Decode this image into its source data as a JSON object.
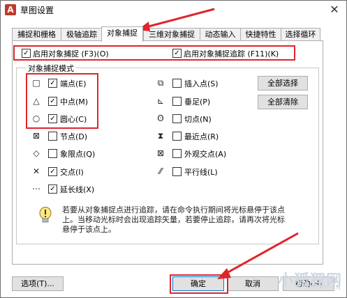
{
  "window": {
    "title": "草图设置",
    "close_glyph": "✕"
  },
  "tabs": [
    {
      "label": "捕捉和栅格"
    },
    {
      "label": "极轴追踪"
    },
    {
      "label": "对象捕捉",
      "active": true
    },
    {
      "label": "三维对象捕捉"
    },
    {
      "label": "动态输入"
    },
    {
      "label": "快捷特性"
    },
    {
      "label": "选择循环"
    }
  ],
  "top_checks": {
    "osnap_on": {
      "label": "启用对象捕捉 (F3)(O)",
      "checked": true
    },
    "tracking_on": {
      "label": "启用对象捕捉追踪 (F11)(K)",
      "checked": true
    }
  },
  "group_title": "对象捕捉模式",
  "left_modes": [
    {
      "icon": "□",
      "icon_name": "endpoint-icon",
      "label": "端点(E)",
      "checked": true
    },
    {
      "icon": "△",
      "icon_name": "midpoint-icon",
      "label": "中点(M)",
      "checked": true
    },
    {
      "icon": "○",
      "icon_name": "center-icon",
      "label": "圆心(C)",
      "checked": true
    },
    {
      "icon": "⊠",
      "icon_name": "node-icon",
      "label": "节点(D)",
      "checked": false
    },
    {
      "icon": "◇",
      "icon_name": "quadrant-icon",
      "label": "象限点(Q)",
      "checked": false
    },
    {
      "icon": "✕",
      "icon_name": "intersection-icon",
      "label": "交点(I)",
      "checked": true
    },
    {
      "icon": "⋯",
      "icon_name": "extension-icon",
      "label": "延长线(X)",
      "checked": true
    }
  ],
  "right_modes": [
    {
      "icon": "⧉",
      "icon_name": "insertion-icon",
      "label": "插入点(S)",
      "checked": false
    },
    {
      "icon": "⊾",
      "icon_name": "perpendicular-icon",
      "label": "垂足(P)",
      "checked": false
    },
    {
      "icon": "ʘ",
      "icon_name": "tangent-icon",
      "label": "切点(N)",
      "checked": false
    },
    {
      "icon": "⧗",
      "icon_name": "nearest-icon",
      "label": "最近点(R)",
      "checked": false
    },
    {
      "icon": "⊠",
      "icon_name": "apparent-intersection-icon",
      "label": "外观交点(A)",
      "checked": false
    },
    {
      "icon": "⁄⁄",
      "icon_name": "parallel-icon",
      "label": "平行线(L)",
      "checked": false
    }
  ],
  "buttons": {
    "select_all": "全部选择",
    "clear_all": "全部清除",
    "options": "选项(T)...",
    "ok": "确定",
    "cancel": "取消",
    "help": "帮助(H)"
  },
  "info": "若要从对象捕捉点进行追踪，请在命令执行期间将光标悬停于该点上。当移动光标时会出现追踪矢量，若要停止追踪，请再次将光标悬停于该点上。",
  "watermark": {
    "text": "小狐狸网",
    "sub": "XHLSX.CN"
  },
  "colors": {
    "highlight": "#e0242b",
    "accent": "#0078d7"
  }
}
